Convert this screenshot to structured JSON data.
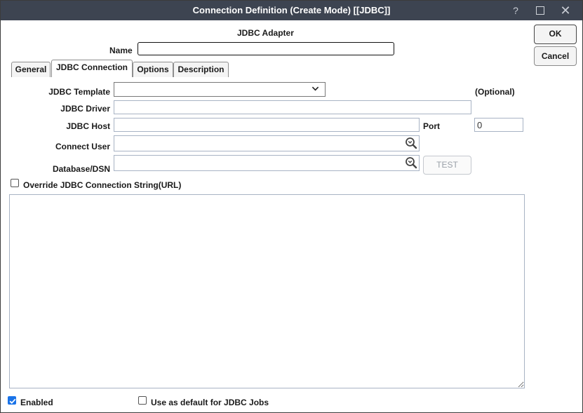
{
  "window": {
    "title": "Connection Definition (Create Mode) [[JDBC]]",
    "help_glyph": "?",
    "close_glyph": "✕"
  },
  "header": {
    "adapter_title": "JDBC Adapter"
  },
  "name_field": {
    "label": "Name",
    "value": ""
  },
  "buttons": {
    "ok": "OK",
    "cancel": "Cancel",
    "test": "TEST"
  },
  "tabs": [
    {
      "label": "General",
      "active": false
    },
    {
      "label": "JDBC Connection",
      "active": true
    },
    {
      "label": "Options",
      "active": false
    },
    {
      "label": "Description",
      "active": false
    }
  ],
  "form": {
    "jdbc_template": {
      "label": "JDBC Template",
      "value": "",
      "hint": "(Optional)"
    },
    "jdbc_driver": {
      "label": "JDBC Driver",
      "value": ""
    },
    "jdbc_host": {
      "label": "JDBC Host",
      "value": ""
    },
    "port": {
      "label": "Port",
      "value": "0"
    },
    "connect_user": {
      "label": "Connect User",
      "value": ""
    },
    "database_dsn": {
      "label": "Database/DSN",
      "value": ""
    }
  },
  "override": {
    "label": "Override JDBC Connection String(URL)",
    "checked": false,
    "text": ""
  },
  "footer": {
    "enabled": {
      "label": "Enabled",
      "checked": true
    },
    "default_jobs": {
      "label": "Use as default for JDBC Jobs",
      "checked": false
    }
  },
  "colors": {
    "titlebar": "#3d4451",
    "accent_checkbox": "#1a73e8",
    "input_border": "#a8b3c4"
  },
  "icons": {
    "select_arrow": "chevron-down-icon",
    "lookup": "magnifier-lookup-icon",
    "maximize": "maximize-icon",
    "close": "close-icon",
    "help": "help-icon"
  }
}
